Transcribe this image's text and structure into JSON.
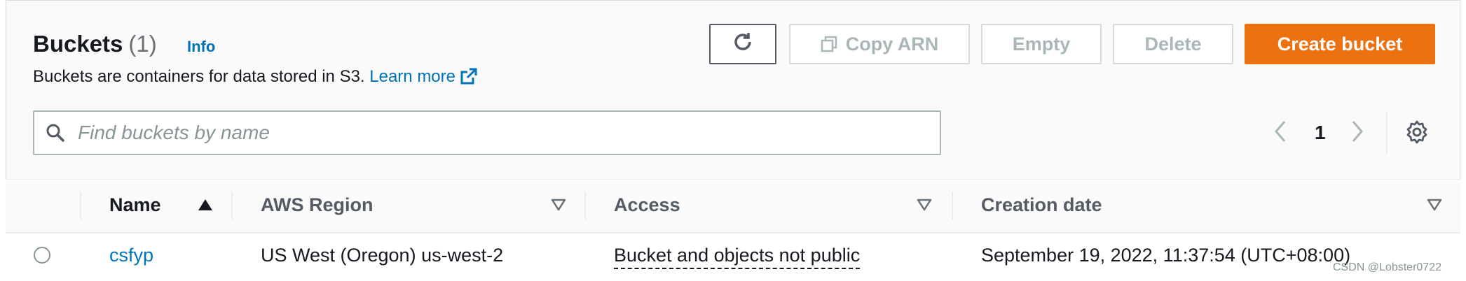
{
  "header": {
    "title": "Buckets",
    "count": "(1)",
    "info_label": "Info",
    "description": "Buckets are containers for data stored in S3.",
    "learn_more": "Learn more"
  },
  "actions": {
    "copy_arn": "Copy ARN",
    "empty": "Empty",
    "delete": "Delete",
    "create_bucket": "Create bucket"
  },
  "search": {
    "placeholder": "Find buckets by name",
    "value": ""
  },
  "pagination": {
    "current_page": "1"
  },
  "table": {
    "columns": [
      "Name",
      "AWS Region",
      "Access",
      "Creation date"
    ],
    "rows": [
      {
        "name": "csfyp",
        "region": "US West (Oregon) us-west-2",
        "access": "Bucket and objects not public",
        "creation_date": "September 19, 2022, 11:37:54 (UTC+08:00)"
      }
    ]
  },
  "watermark": "CSDN @Lobster0722",
  "colors": {
    "primary_button": "#ec7211",
    "link": "#0073bb",
    "disabled_text": "#aab7b8"
  },
  "icons": [
    "refresh-icon",
    "copy-icon",
    "external-link-icon",
    "search-icon",
    "chevron-left-icon",
    "chevron-right-icon",
    "settings-gear-icon",
    "sort-ascending-icon",
    "sort-dropdown-icon"
  ]
}
